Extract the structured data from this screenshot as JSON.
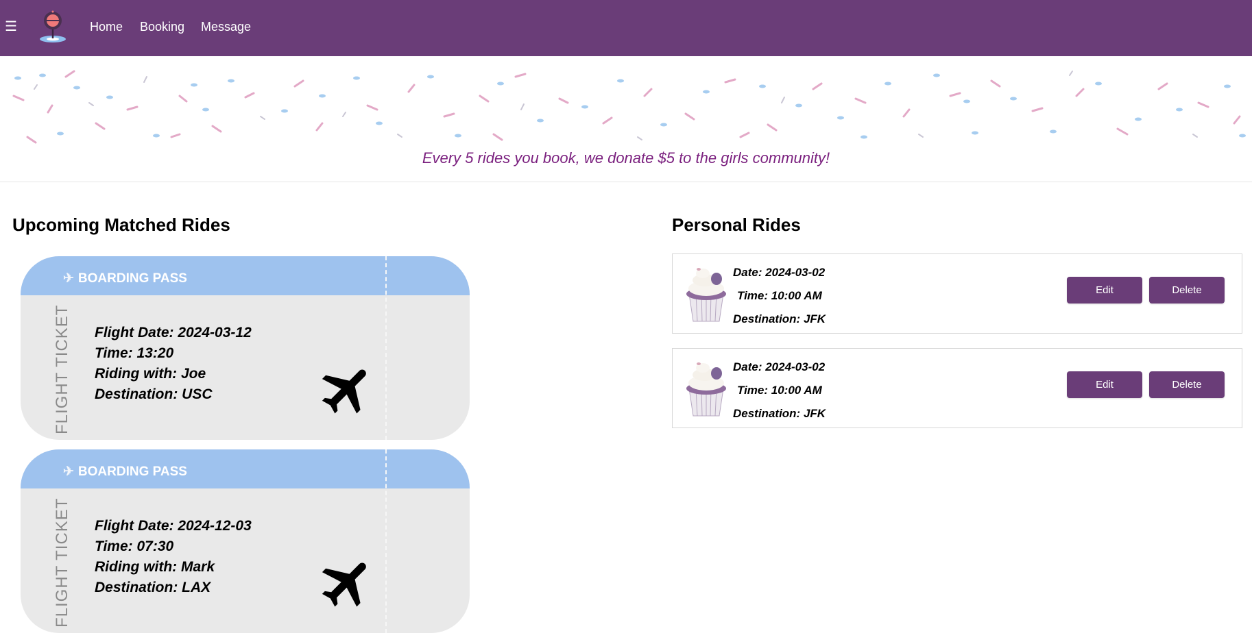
{
  "nav": {
    "menu_icon": "hamburger-icon",
    "logo": "app-logo-pin",
    "links": [
      "Home",
      "Booking",
      "Message"
    ]
  },
  "banner": {
    "message": "Every 5 rides you book, we donate $5 to the girls community!"
  },
  "upcoming": {
    "title": "Upcoming Matched Rides",
    "tickets": [
      {
        "header": "BOARDING PASS",
        "side_label": "FLIGHT TICKET",
        "flight_date": "Flight Date: 2024-03-12",
        "time": "Time: 13:20",
        "riding_with": "Riding with: Joe",
        "destination": "Destination: USC"
      },
      {
        "header": "BOARDING PASS",
        "side_label": "FLIGHT TICKET",
        "flight_date": "Flight Date: 2024-12-03",
        "time": "Time: 07:30",
        "riding_with": "Riding with: Mark",
        "destination": "Destination: LAX"
      }
    ]
  },
  "personal": {
    "title": "Personal Rides",
    "rides": [
      {
        "date": "Date: 2024-03-02",
        "time": "Time: 10:00 AM",
        "destination": "Destination: JFK",
        "edit_label": "Edit",
        "delete_label": "Delete"
      },
      {
        "date": "Date: 2024-03-02",
        "time": "Time: 10:00 AM",
        "destination": "Destination: JFK",
        "edit_label": "Edit",
        "delete_label": "Delete"
      }
    ]
  },
  "colors": {
    "navbar": "#6a3d78",
    "ticket_header": "#9ec2ee",
    "ticket_body": "#e9e9e9",
    "donate_text": "#7a1f7e",
    "button": "#6a3d78"
  }
}
